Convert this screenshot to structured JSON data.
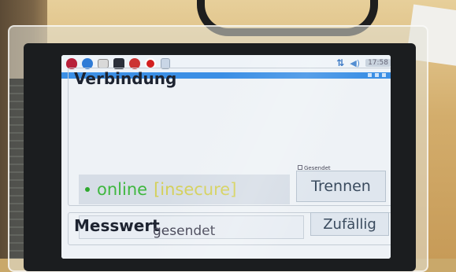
{
  "taskbar": {
    "icons": [
      "raspberry-menu-icon",
      "browser-globe-icon",
      "file-manager-icon",
      "terminal-icon",
      "settings-gear-icon",
      "wolfram-icon",
      "app-window-icon"
    ],
    "tray": {
      "network": "⇅",
      "volume": "◀)",
      "clock": "17:58"
    }
  },
  "window": {
    "title": ""
  },
  "verbindung": {
    "title": "Verbindung",
    "status_online": "online",
    "status_secure": "[insecure]",
    "sent_label": "Gesendet",
    "disconnect_label": "Trennen"
  },
  "messwert": {
    "title": "Messwert",
    "value_text": "gesendet",
    "random_label": "Zufällig"
  },
  "colors": {
    "accent": "#3b8fe5",
    "online": "#3fb73f",
    "insecure": "#d4d05a"
  }
}
